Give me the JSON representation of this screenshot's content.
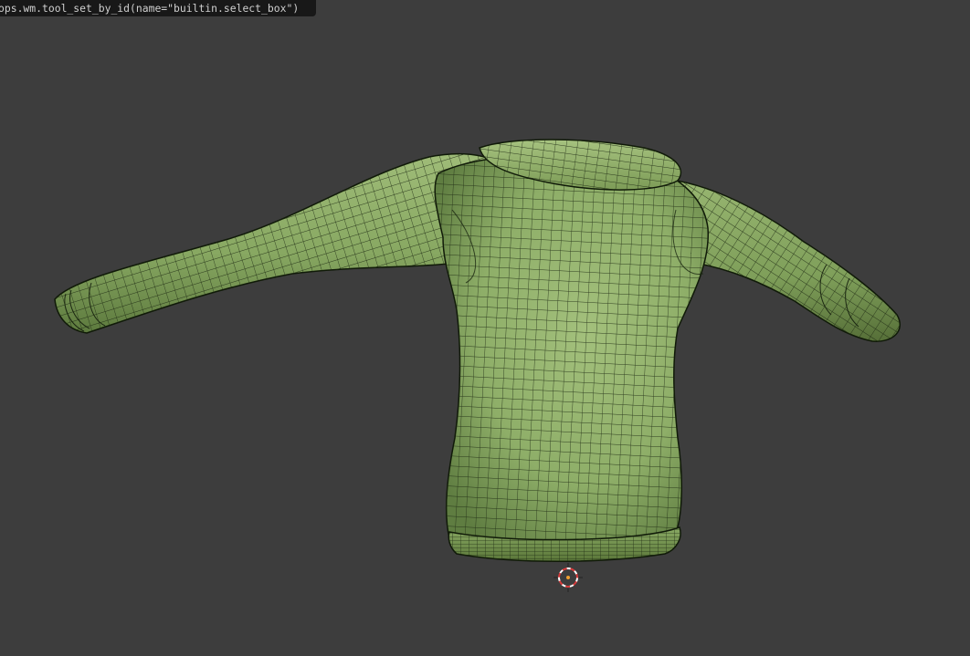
{
  "tooltip": {
    "text": "ops.wm.tool_set_by_id(name=\"builtin.select_box\")"
  },
  "viewport": {
    "background": "#3d3d3d",
    "model_color": "#8fb06a",
    "model_shadow_color": "#5d7a3e",
    "wire_color": "#1e2a14",
    "cursor_color": "#d83a3a"
  }
}
